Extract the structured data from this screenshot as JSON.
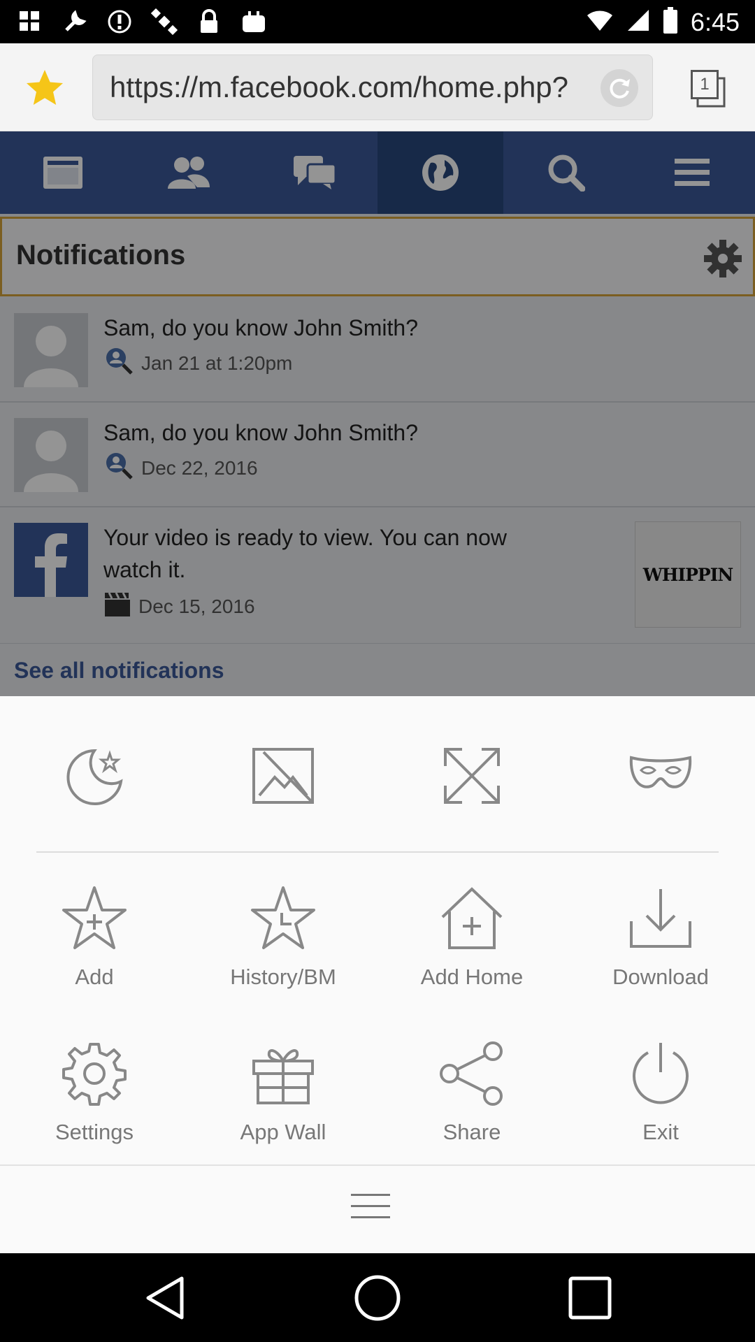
{
  "status_bar": {
    "time": "6:45",
    "left_icons": [
      "app-icon",
      "wrench-icon",
      "alert-icon",
      "satellite-icon",
      "lock-icon",
      "bag-icon"
    ],
    "right_icons": [
      "wifi-icon",
      "signal-icon",
      "battery-icon"
    ]
  },
  "browser": {
    "url": "https://m.facebook.com/home.php?",
    "tab_count": "1"
  },
  "fb_nav": {
    "items": [
      "news-feed-icon",
      "friends-icon",
      "messages-icon",
      "globe-icon",
      "search-icon",
      "menu-icon"
    ],
    "active": "globe-icon",
    "color": "#3b5998"
  },
  "notifications": {
    "title": "Notifications",
    "items": [
      {
        "text": "Sam, do you know John Smith?",
        "date": "Jan 21 at 1:20pm",
        "icon": "person-search-icon"
      },
      {
        "text": "Sam, do you know John Smith?",
        "date": "Dec 22, 2016",
        "icon": "person-search-icon"
      },
      {
        "text_line1": "Your video is ready to view. You can now",
        "text_line2": "watch it.",
        "date": "Dec 15, 2016",
        "icon": "clapper-icon",
        "thumbnail_text": "WHIPPIN"
      }
    ],
    "see_all": "See all notifications"
  },
  "menu": {
    "quick_toggles": [
      "night-mode-icon",
      "no-image-icon",
      "fullscreen-icon",
      "incognito-mask-icon"
    ],
    "row1": [
      {
        "label": "Add",
        "icon": "star-add-icon"
      },
      {
        "label": "History/BM",
        "icon": "star-history-icon"
      },
      {
        "label": "Add Home",
        "icon": "home-add-icon"
      },
      {
        "label": "Download",
        "icon": "download-icon"
      }
    ],
    "row2": [
      {
        "label": "Settings",
        "icon": "gear-icon"
      },
      {
        "label": "App Wall",
        "icon": "gift-icon"
      },
      {
        "label": "Share",
        "icon": "share-icon"
      },
      {
        "label": "Exit",
        "icon": "power-icon"
      }
    ]
  }
}
